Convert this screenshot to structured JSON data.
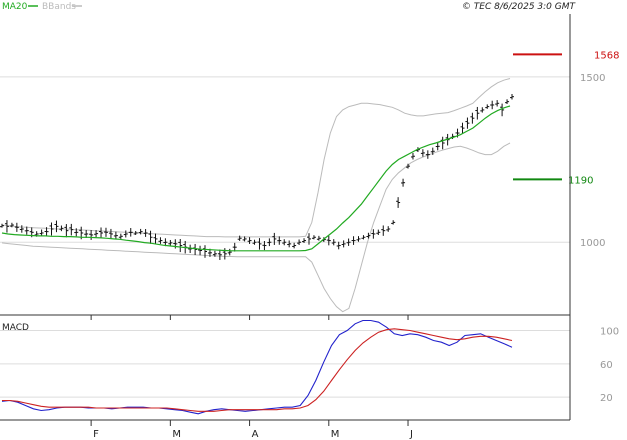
{
  "header": {
    "legend": [
      {
        "label": "MA20",
        "color": "#22aa22"
      },
      {
        "label": "BBands",
        "color": "#bbbbbb"
      }
    ],
    "copyright": "© TEC 8/6/2025 3:0 GMT"
  },
  "chart_data": [
    {
      "type": "line",
      "subtype": "ohlc-price",
      "ylim": [
        780,
        1690
      ],
      "y_ticks": [
        "1500",
        "1000"
      ],
      "y_tick_values": [
        1500,
        1000
      ],
      "x_ticks": [
        "F",
        "M",
        "A",
        "M",
        "J"
      ],
      "x_tick_index": [
        18,
        34,
        50,
        66,
        82
      ],
      "grid": true,
      "series": [
        {
          "name": "MA20",
          "color": "#22aa22",
          "values": [
            1028,
            1025,
            1023,
            1022,
            1021,
            1020,
            1019,
            1019,
            1018,
            1018,
            1017,
            1017,
            1016,
            1015,
            1015,
            1014,
            1013,
            1012,
            1010,
            1009,
            1006,
            1004,
            1002,
            999,
            997,
            994,
            991,
            989,
            987,
            985,
            983,
            981,
            979,
            978,
            977,
            976,
            975,
            974,
            974,
            974,
            974,
            974,
            974,
            974,
            974,
            974,
            974,
            974,
            974,
            975,
            980,
            995,
            1010,
            1025,
            1040,
            1058,
            1075,
            1095,
            1115,
            1140,
            1165,
            1190,
            1215,
            1235,
            1250,
            1260,
            1270,
            1280,
            1288,
            1295,
            1300,
            1306,
            1312,
            1318,
            1325,
            1335,
            1345,
            1360,
            1375,
            1388,
            1398,
            1406,
            1412
          ]
        },
        {
          "name": "BBands upper",
          "color": "#bbbbbb",
          "values": [
            1052,
            1050,
            1048,
            1046,
            1045,
            1044,
            1043,
            1042,
            1041,
            1040,
            1040,
            1039,
            1038,
            1037,
            1036,
            1035,
            1034,
            1033,
            1032,
            1031,
            1030,
            1029,
            1028,
            1027,
            1026,
            1025,
            1024,
            1023,
            1022,
            1021,
            1020,
            1019,
            1018,
            1017,
            1017,
            1017,
            1016,
            1016,
            1016,
            1016,
            1016,
            1016,
            1016,
            1016,
            1016,
            1016,
            1016,
            1016,
            1016,
            1018,
            1060,
            1150,
            1250,
            1330,
            1380,
            1400,
            1410,
            1415,
            1420,
            1420,
            1418,
            1416,
            1412,
            1408,
            1400,
            1390,
            1385,
            1382,
            1382,
            1385,
            1388,
            1390,
            1392,
            1398,
            1405,
            1412,
            1420,
            1438,
            1455,
            1470,
            1482,
            1490,
            1495
          ]
        },
        {
          "name": "BBands lower",
          "color": "#bbbbbb",
          "values": [
            998,
            996,
            994,
            992,
            990,
            988,
            987,
            986,
            985,
            984,
            983,
            982,
            981,
            980,
            979,
            978,
            977,
            976,
            975,
            974,
            973,
            972,
            971,
            970,
            969,
            968,
            967,
            966,
            965,
            964,
            963,
            962,
            961,
            960,
            959,
            958,
            957,
            957,
            956,
            956,
            956,
            956,
            956,
            956,
            956,
            956,
            956,
            956,
            956,
            956,
            940,
            900,
            860,
            830,
            805,
            790,
            800,
            860,
            930,
            1000,
            1060,
            1110,
            1160,
            1190,
            1210,
            1225,
            1240,
            1250,
            1258,
            1265,
            1272,
            1278,
            1283,
            1288,
            1290,
            1285,
            1278,
            1270,
            1265,
            1265,
            1275,
            1290,
            1300
          ]
        }
      ],
      "ohlc_close": [
        1050,
        1048,
        1052,
        1045,
        1040,
        1035,
        1030,
        1025,
        1028,
        1032,
        1040,
        1048,
        1042,
        1035,
        1038,
        1030,
        1028,
        1025,
        1022,
        1026,
        1028,
        1030,
        1025,
        1020,
        1018,
        1025,
        1030,
        1028,
        1032,
        1028,
        1015,
        1010,
        1005,
        1000,
        998,
        995,
        990,
        985,
        980,
        978,
        975,
        972,
        968,
        965,
        962,
        965,
        970,
        985,
        1012,
        1010,
        1005,
        1000,
        995,
        990,
        1000,
        1010,
        1005,
        1000,
        995,
        990,
        1000,
        1005,
        1010,
        1015,
        1012,
        1008,
        1005,
        1000,
        990,
        995,
        1000,
        1005,
        1010,
        1015,
        1020,
        1025,
        1030,
        1035,
        1040,
        1060,
        1120,
        1180,
        1230,
        1260,
        1280,
        1270,
        1265,
        1275,
        1290,
        1300,
        1310,
        1320,
        1330,
        1345,
        1360,
        1375,
        1390,
        1400,
        1410,
        1415,
        1420,
        1400,
        1425,
        1440
      ],
      "annotations": [
        {
          "label": "1568",
          "value": 1568,
          "color": "#cc1111"
        },
        {
          "label": "1190",
          "value": 1190,
          "color": "#118811"
        }
      ]
    },
    {
      "type": "line",
      "subtype": "macd",
      "title": "MACD",
      "ylim": [
        -5,
        115
      ],
      "y_ticks": [
        "100",
        "60",
        "20"
      ],
      "y_tick_values": [
        100,
        60,
        20
      ],
      "grid": true,
      "series": [
        {
          "name": "MACD",
          "color": "#2222cc",
          "values": [
            15,
            16,
            14,
            10,
            6,
            4,
            5,
            7,
            8,
            8,
            8,
            7,
            7,
            7,
            6,
            7,
            8,
            8,
            8,
            7,
            7,
            6,
            5,
            4,
            2,
            0,
            3,
            5,
            6,
            5,
            4,
            3,
            4,
            5,
            6,
            7,
            8,
            8,
            10,
            22,
            40,
            62,
            82,
            95,
            100,
            108,
            112,
            112,
            110,
            104,
            96,
            94,
            96,
            95,
            92,
            88,
            86,
            82,
            86,
            94,
            95,
            96,
            92,
            88,
            84,
            80
          ]
        },
        {
          "name": "Signal",
          "color": "#cc2222",
          "values": [
            16,
            16,
            15,
            13,
            11,
            9,
            8,
            8,
            8,
            8,
            8,
            8,
            7,
            7,
            7,
            7,
            7,
            7,
            7,
            7,
            7,
            7,
            6,
            5,
            4,
            3,
            3,
            3,
            4,
            5,
            5,
            5,
            5,
            5,
            5,
            5,
            6,
            6,
            7,
            10,
            17,
            27,
            40,
            53,
            65,
            76,
            85,
            92,
            98,
            101,
            102,
            101,
            100,
            98,
            96,
            94,
            92,
            90,
            89,
            90,
            92,
            93,
            93,
            92,
            90,
            88
          ]
        }
      ]
    }
  ]
}
